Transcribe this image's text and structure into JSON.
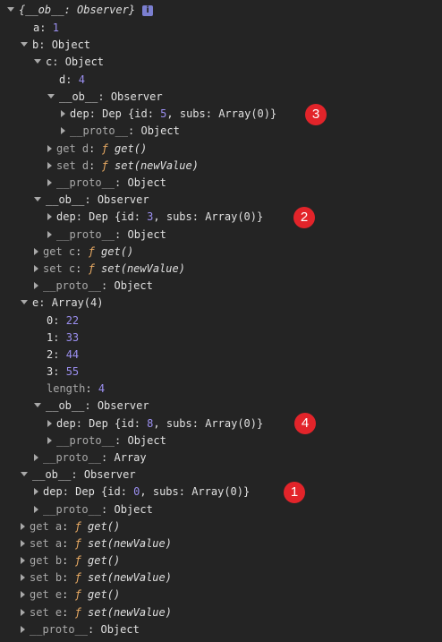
{
  "header": {
    "text": "{__ob__: Observer}",
    "info_icon": "i"
  },
  "rows": {
    "a_key": "a",
    "a_val": "1",
    "b_key": "b",
    "b_val": "Object",
    "c_key": "c",
    "c_val": "Object",
    "d_key": "d",
    "d_val": "4",
    "ob_key": "__ob__",
    "ob_val": "Observer",
    "dep_key": "dep",
    "dep_prefix": "Dep {id: ",
    "dep_mid": ", subs: Array(0)}",
    "dep5_id": "5",
    "dep3_id": "3",
    "dep8_id": "8",
    "dep0_id": "0",
    "proto_key": "__proto__",
    "proto_obj": "Object",
    "proto_arr": "Array",
    "get_d": "get d",
    "set_d": "set d",
    "get_c": "get c",
    "set_c": "set c",
    "e_key": "e",
    "e_val": "Array(4)",
    "e0_key": "0",
    "e0_val": "22",
    "e1_key": "1",
    "e1_val": "33",
    "e2_key": "2",
    "e2_val": "44",
    "e3_key": "3",
    "e3_val": "55",
    "len_key": "length",
    "len_val": "4",
    "get_a": "get a",
    "set_a": "set a",
    "get_b": "get b",
    "set_b": "set b",
    "get_e": "get e",
    "set_e": "set e",
    "fn_symbol": "ƒ",
    "get_fn": "get()",
    "set_fn": "set(newValue)"
  },
  "badges": {
    "b1": "1",
    "b2": "2",
    "b3": "3",
    "b4": "4"
  },
  "colors": {
    "badge": "#e2242a",
    "number": "#9b8ff0",
    "function": "#e8aa63"
  }
}
